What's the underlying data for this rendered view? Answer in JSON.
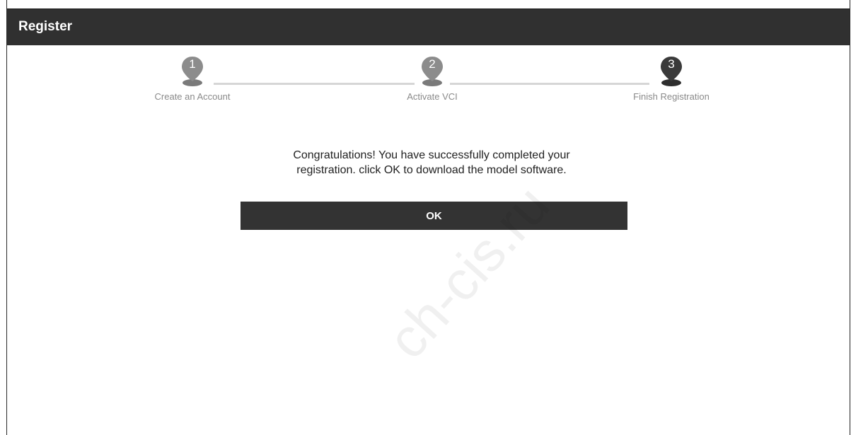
{
  "window": {
    "title": "Register"
  },
  "stepper": {
    "steps": [
      {
        "number": "1",
        "label": "Create an Account",
        "state": "done",
        "color": "#8c8c8c"
      },
      {
        "number": "2",
        "label": "Activate VCI",
        "state": "done",
        "color": "#8c8c8c"
      },
      {
        "number": "3",
        "label": "Finish Registration",
        "state": "current",
        "color": "#3a3a3a"
      }
    ]
  },
  "main": {
    "message_line1": "Congratulations! You have successfully completed your",
    "message_line2": "registration. click OK to download the model software.",
    "ok_label": "OK"
  },
  "watermark": {
    "text": "ch-cis.ru"
  },
  "colors": {
    "titlebar": "#303030",
    "button": "#333333",
    "step_line": "#d6d6d6"
  }
}
